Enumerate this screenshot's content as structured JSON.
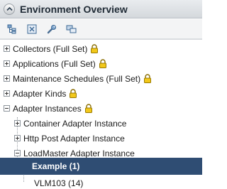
{
  "panel": {
    "title": "Environment Overview"
  },
  "toolbar": {
    "buttons": [
      {
        "icon": "expand-tree-icon"
      },
      {
        "icon": "collapse-tree-icon"
      },
      {
        "icon": "wrench-icon"
      },
      {
        "icon": "refresh-icon"
      }
    ]
  },
  "tree": {
    "items": [
      {
        "label": "Collectors (Full Set)",
        "state": "collapsed",
        "locked": true
      },
      {
        "label": "Applications (Full Set)",
        "state": "collapsed",
        "locked": true
      },
      {
        "label": "Maintenance Schedules (Full Set)",
        "state": "collapsed",
        "locked": true
      },
      {
        "label": "Adapter Kinds",
        "state": "collapsed",
        "locked": true
      },
      {
        "label": "Adapter Instances",
        "state": "expanded",
        "locked": true
      },
      {
        "label": "Container Adapter Instance",
        "state": "collapsed",
        "locked": false
      },
      {
        "label": "Http Post Adapter Instance",
        "state": "collapsed",
        "locked": false
      },
      {
        "label": "LoadMaster Adapter Instance",
        "state": "expanded",
        "locked": false
      },
      {
        "label": "Example (1)",
        "state": "leaf",
        "locked": false,
        "selected": true
      },
      {
        "label": "VLM103 (14)",
        "state": "leaf",
        "locked": false
      }
    ]
  },
  "colors": {
    "selection": "#2f4d73",
    "lock": "#e6b800"
  }
}
